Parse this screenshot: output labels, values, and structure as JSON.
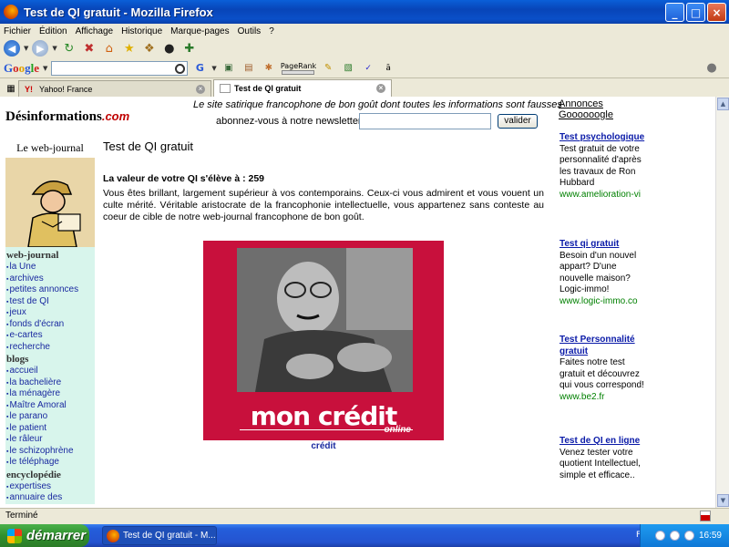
{
  "window": {
    "title": "Test de QI gratuit - Mozilla Firefox",
    "buttons": {
      "minimize": "_",
      "maximize": "□",
      "close": "×"
    }
  },
  "menu": [
    "Fichier",
    "Édition",
    "Affichage",
    "Historique",
    "Marque-pages",
    "Outils",
    "?"
  ],
  "google_toolbar": {
    "logo": "Google",
    "pagerank_label": "PageRank"
  },
  "tabs": [
    {
      "label": "Yahoo! France",
      "active": false
    },
    {
      "label": "Test de QI gratuit",
      "active": true
    }
  ],
  "site": {
    "logo_main": "Désinformations",
    "logo_suffix": ".com",
    "slogan": "Le site satirique francophone de bon goût dont toutes les informations sont fausses",
    "newsletter_label": "abonnez-vous à notre newsletter :",
    "newsletter_button": "valider",
    "ads_top": [
      "Annonces",
      "Goooooogle"
    ]
  },
  "sidebar": {
    "header": "Le web-journal",
    "sections": [
      {
        "title": "web-journal",
        "items": [
          "la Une",
          "archives",
          "petites annonces",
          "test de QI",
          "jeux",
          "fonds d'écran",
          "e-cartes",
          "recherche"
        ]
      },
      {
        "title": "blogs",
        "items": [
          "accueil",
          "la bachelière",
          "la ménagère",
          "Maître Amoral",
          "le parano",
          "le patient",
          "le râleur",
          "le schizophrène",
          "le téléphage"
        ]
      },
      {
        "title": "encyclopédie",
        "items": [
          "expertises",
          "annuaire des"
        ]
      }
    ]
  },
  "main": {
    "title": "Test de QI gratuit",
    "result": "La valeur de votre QI s'élève à : 259",
    "description": "Vous êtes brillant, largement supérieur à vos contemporains. Ceux-ci vous admirent et vous vouent un culte mérité. Véritable aristocrate de la francophonie intellectuelle, vous appartenez sans conteste au coeur de cible de notre web-journal francophone de bon goût.",
    "promo_title": "mon crédit",
    "promo_subtitle": "online",
    "promo_caption": "crédit"
  },
  "ads": [
    {
      "title": "Test psychologique",
      "body": "Test gratuit de votre personnalité d'après les travaux de Ron Hubbard",
      "url": "www.amelioration-vi"
    },
    {
      "title": "Test qi gratuit",
      "body": "Besoin d'un nouvel appart? D'une nouvelle maison? Logic-immo!",
      "url": "www.logic-immo.co"
    },
    {
      "title": "Test Personnalité gratuit",
      "body": "Faites notre test gratuit et découvrez qui vous correspond!",
      "url": "www.be2.fr"
    },
    {
      "title": "Test de QI en ligne",
      "body": "Venez tester votre quotient Intellectuel, simple et efficace..",
      "url": ""
    }
  ],
  "status": "Terminé",
  "taskbar": {
    "start": "démarrer",
    "task": "Test de QI gratuit - M...",
    "lang": "FR",
    "clock": "16:59"
  },
  "colors": {
    "brand_red": "#c8103c",
    "link_blue": "#0a1aa8",
    "url_green": "#008000",
    "sidebar_bg": "#d8f5ec"
  }
}
